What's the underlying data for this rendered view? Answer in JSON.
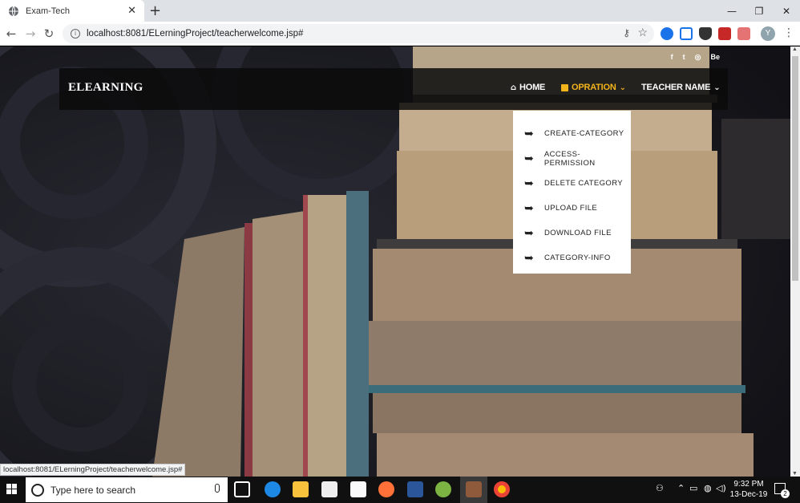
{
  "browser": {
    "tab_title": "Exam-Tech",
    "tab_close": "✕",
    "new_tab": "+",
    "url": "localhost:8081/ELerningProject/teacherwelcome.jsp#",
    "window_controls": {
      "minimize": "—",
      "restore": "❐",
      "close": "✕"
    },
    "profile_initial": "Y",
    "status_url": "localhost:8081/ELerningProject/teacherwelcome.jsp#"
  },
  "site": {
    "social": [
      "f",
      "t",
      "◎",
      "Be"
    ],
    "brand": "ELEARNING",
    "nav": {
      "home": "HOME",
      "opration": "OPRATION",
      "teacher": "TEACHER NAME"
    },
    "dropdown": [
      {
        "label": "CREATE-CATEGORY",
        "icon": "sign-in-icon"
      },
      {
        "label": "ACCESS-PERMISSION",
        "icon": "sign-in-icon"
      },
      {
        "label": "DELETE CATEGORY",
        "icon": "sign-in-icon"
      },
      {
        "label": "UPLOAD FILE",
        "icon": "sign-in-icon"
      },
      {
        "label": "DOWNLOAD FILE",
        "icon": "sign-in-icon"
      },
      {
        "label": "CATEGORY-INFO",
        "icon": "sign-in-icon"
      }
    ],
    "accent_color": "#f3b41b"
  },
  "taskbar": {
    "search_placeholder": "Type here to search",
    "time": "9:32 PM",
    "date": "13-Dec-19",
    "notification_count": "2"
  }
}
